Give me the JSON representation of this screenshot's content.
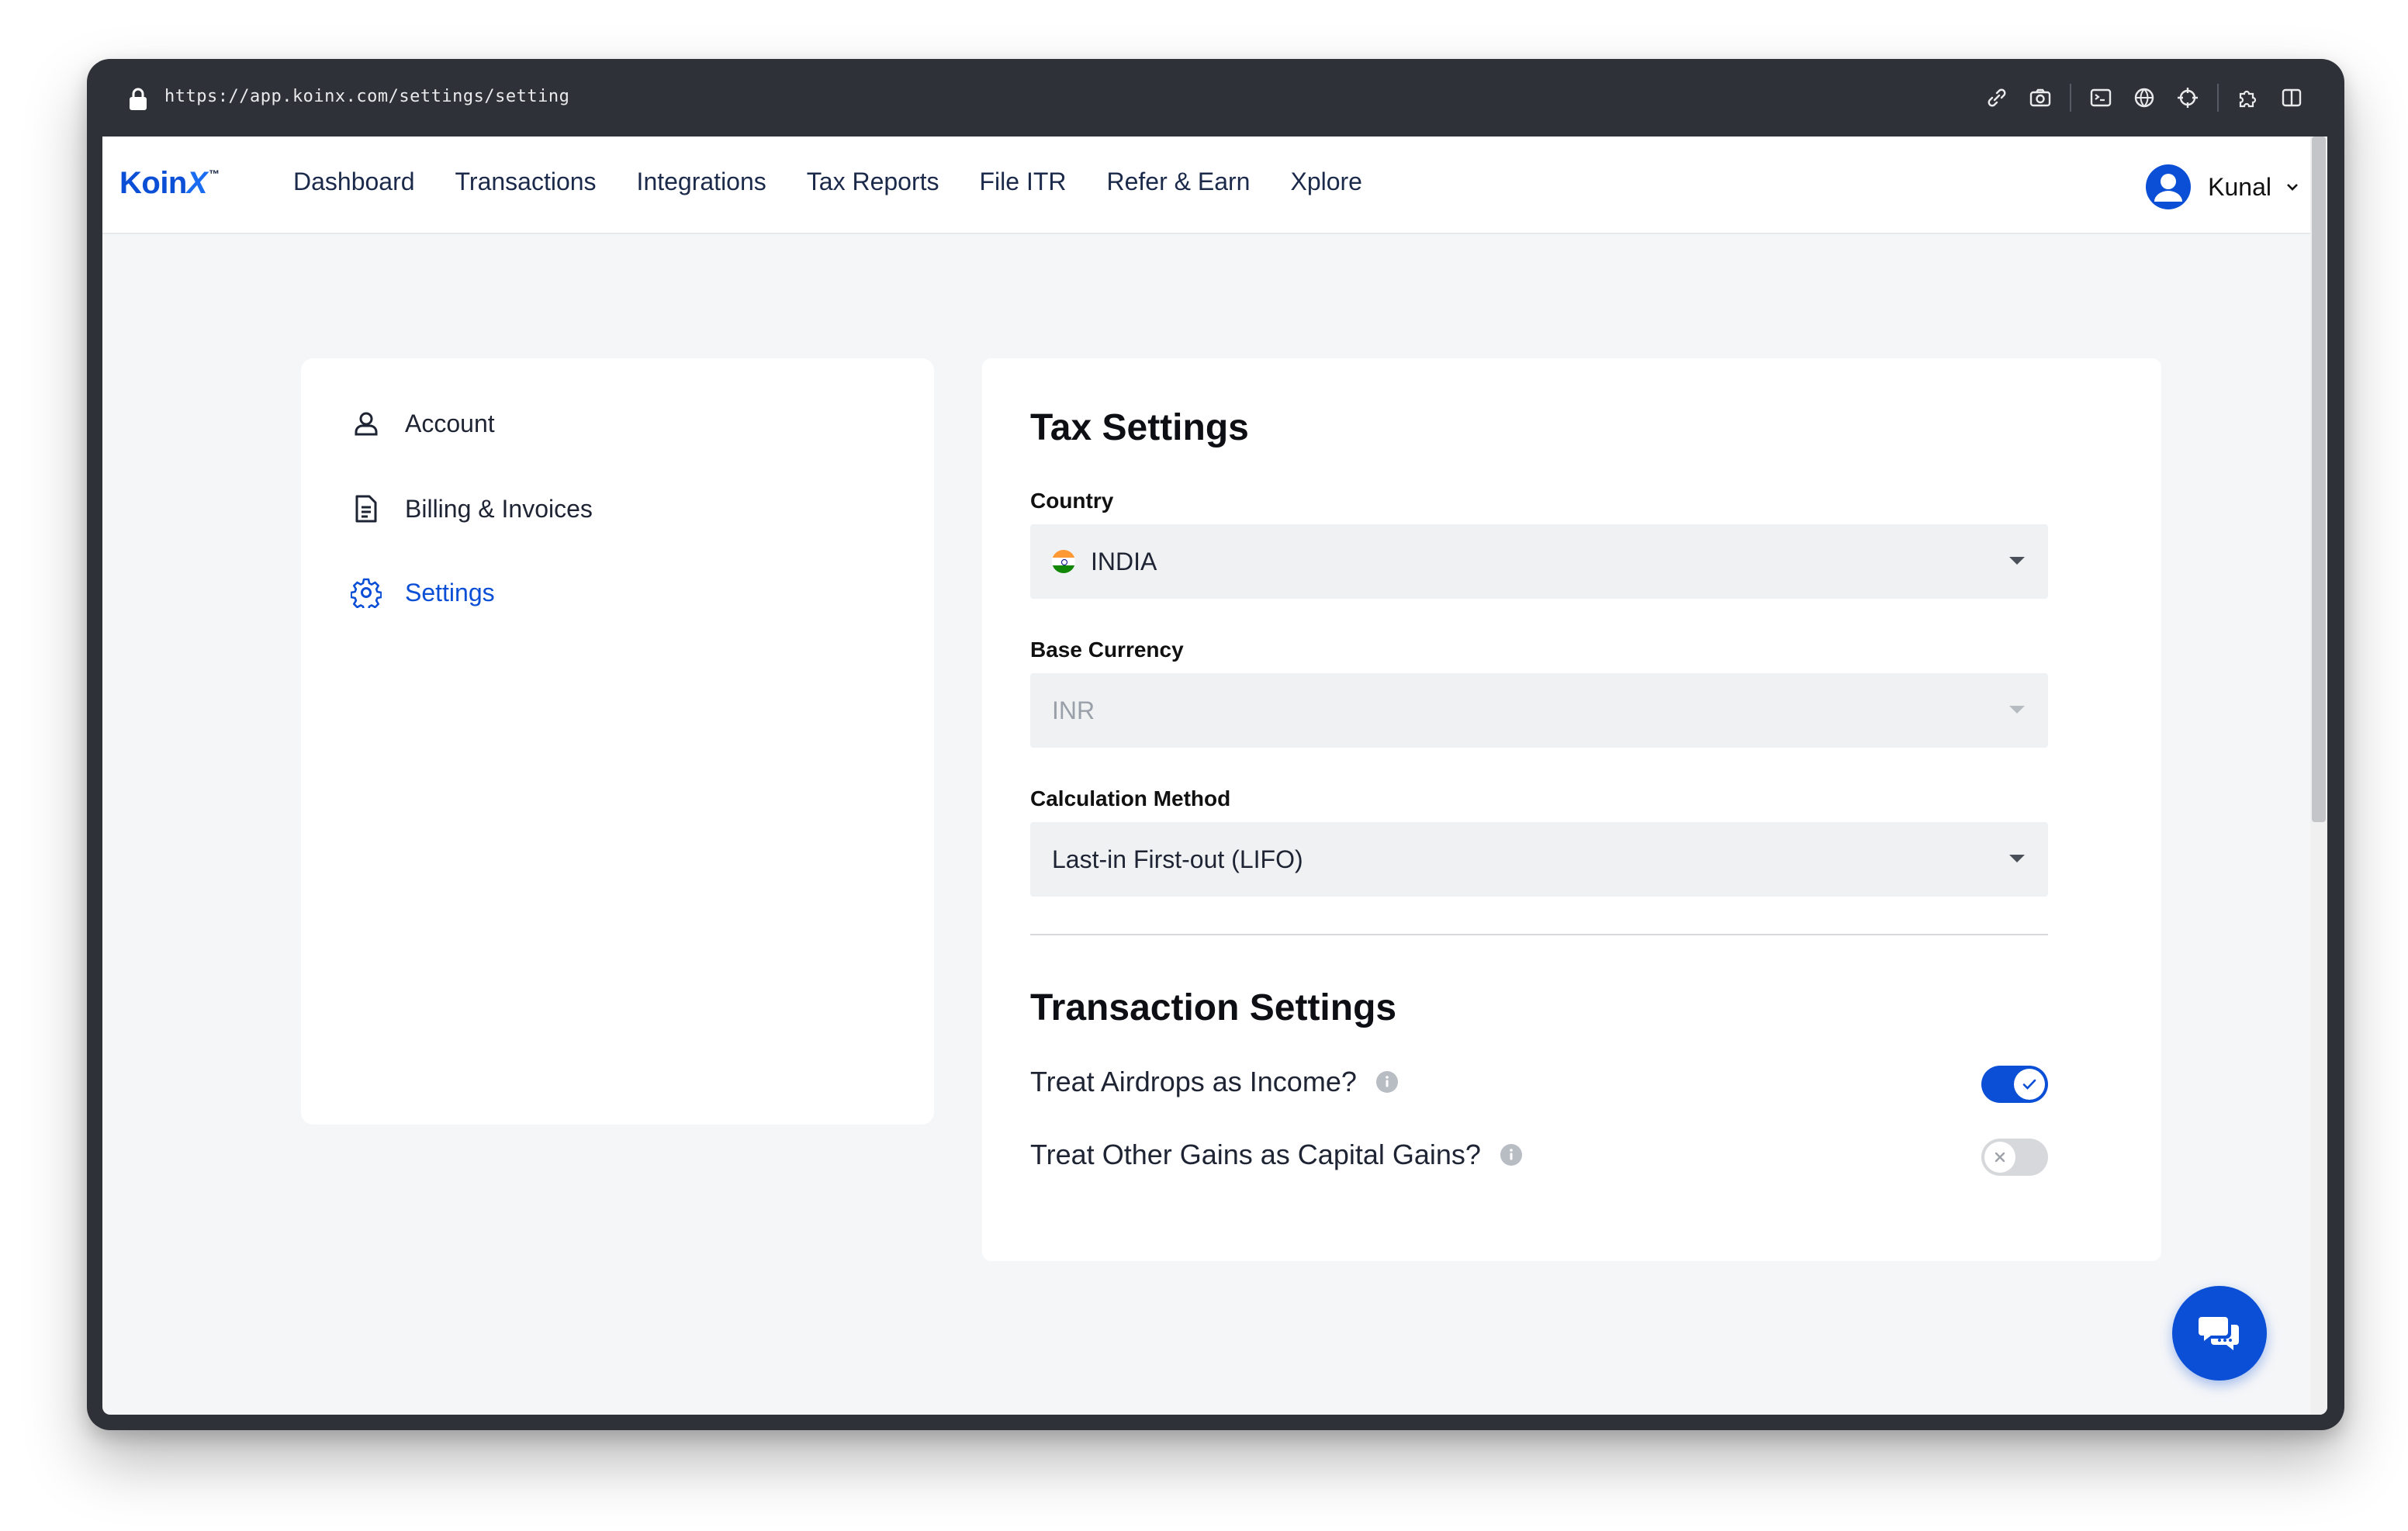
{
  "browser": {
    "url": "https://app.koinx.com/settings/setting",
    "icons": [
      "link-icon",
      "camera-icon",
      "terminal-icon",
      "globe-icon",
      "crosshair-icon",
      "extensions-icon",
      "sidebar-icon"
    ]
  },
  "nav": {
    "logo_text": "Koin",
    "logo_x": "X",
    "logo_tm": "™",
    "links": [
      "Dashboard",
      "Transactions",
      "Integrations",
      "Tax Reports",
      "File ITR",
      "Refer & Earn",
      "Xplore"
    ],
    "user_name": "Kunal"
  },
  "sidebar": {
    "items": [
      {
        "label": "Account",
        "icon": "user-icon"
      },
      {
        "label": "Billing & Invoices",
        "icon": "document-icon"
      },
      {
        "label": "Settings",
        "icon": "gear-icon",
        "active": true
      }
    ]
  },
  "tax_settings": {
    "title": "Tax Settings",
    "country_label": "Country",
    "country_value": "INDIA",
    "base_currency_label": "Base Currency",
    "base_currency_value": "INR",
    "calc_method_label": "Calculation Method",
    "calc_method_value": "Last-in First-out (LIFO)"
  },
  "transaction_settings": {
    "title": "Transaction Settings",
    "toggles": [
      {
        "label": "Treat Airdrops as Income?",
        "on": true
      },
      {
        "label": "Treat Other Gains as Capital Gains?",
        "on": false
      }
    ]
  },
  "colors": {
    "accent": "#0b4fd6",
    "panel_bg": "#ffffff",
    "page_bg": "#f5f6f8"
  }
}
